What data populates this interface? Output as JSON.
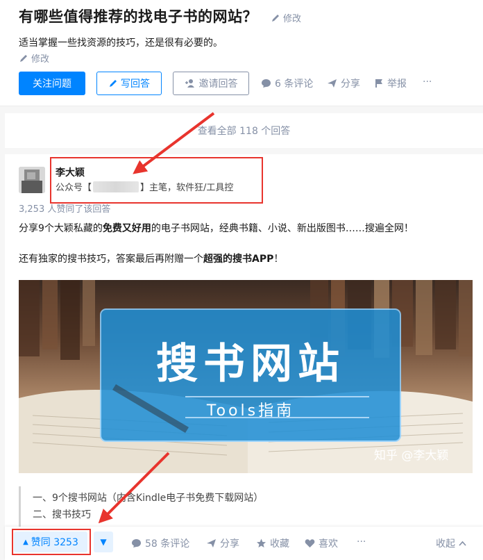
{
  "question": {
    "title": "有哪些值得推荐的找电子书的网站？",
    "edit_label": "修改",
    "description": "适当掌握一些找资源的技巧，还是很有必要的。",
    "desc_edit_label": "修改",
    "buttons": {
      "follow": "关注问题",
      "write": "写回答",
      "invite": "邀请回答"
    },
    "actions": {
      "comments": "6 条评论",
      "share": "分享",
      "report": "举报",
      "more": "···"
    }
  },
  "view_all": "查看全部 118 个回答",
  "answer": {
    "author_name": "李大颖",
    "author_bio_prefix": "公众号【",
    "author_bio_suffix": "】主笔，软件狂/工具控",
    "upvote_text": "3,253 人赞同了该回答",
    "para1_a": "分享9个大颖私藏的",
    "para1_b": "免费又好用",
    "para1_c": "的电子书网站，经典书籍、小说、新出版图书……搜遍全网！",
    "para2_a": "还有独家的搜书技巧，答案最后再附赠一个",
    "para2_b": "超强的搜书APP",
    "para2_c": "！",
    "hero": {
      "title": "搜书网站",
      "subtitle": "Tools指南",
      "watermark": "知乎 @李大颖"
    },
    "outline": [
      "一、9个搜书网站（内含Kindle电子书免费下载网站）",
      "二、搜书技巧"
    ]
  },
  "action_bar": {
    "upvote": "赞同 3253",
    "comments": "58 条评论",
    "share": "分享",
    "favorite": "收藏",
    "like": "喜欢",
    "more": "···",
    "collapse": "收起"
  },
  "colors": {
    "brand": "#0084ff",
    "annotation": "#e8342d",
    "muted": "#8590a6"
  }
}
